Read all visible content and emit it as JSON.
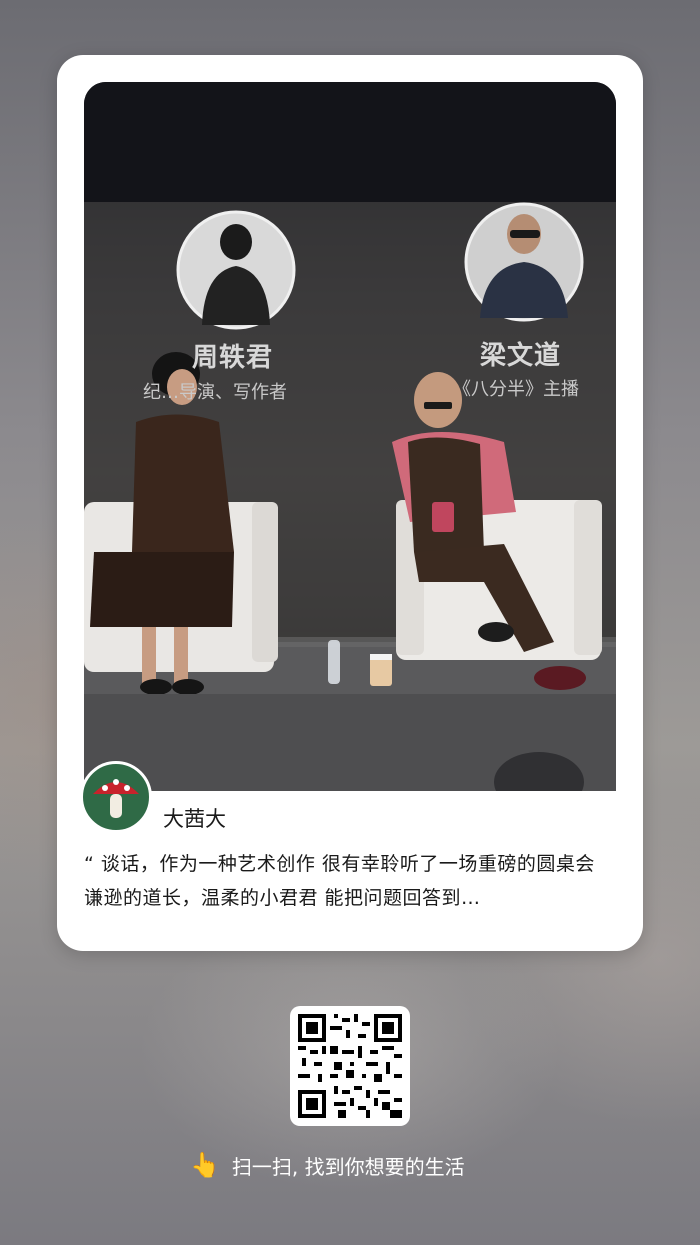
{
  "post": {
    "author": "大茜大",
    "quote": "“ 谈话，作为一种艺术创作 很有幸聆听了一场重磅的圆桌会 谦逊的道长，温柔的小君君 能把问题回答到…",
    "photo": {
      "guest_left": {
        "name": "周轶君",
        "role": "纪…导演、写作者"
      },
      "guest_right": {
        "name": "梁文道",
        "role": "《八分半》主播"
      }
    },
    "avatar_icon": "mushroom-icon"
  },
  "qr": {
    "icon": "qr-code-icon"
  },
  "footer": {
    "icon": "pointing-hand-icon",
    "text": "扫一扫, 找到你想要的生活"
  }
}
